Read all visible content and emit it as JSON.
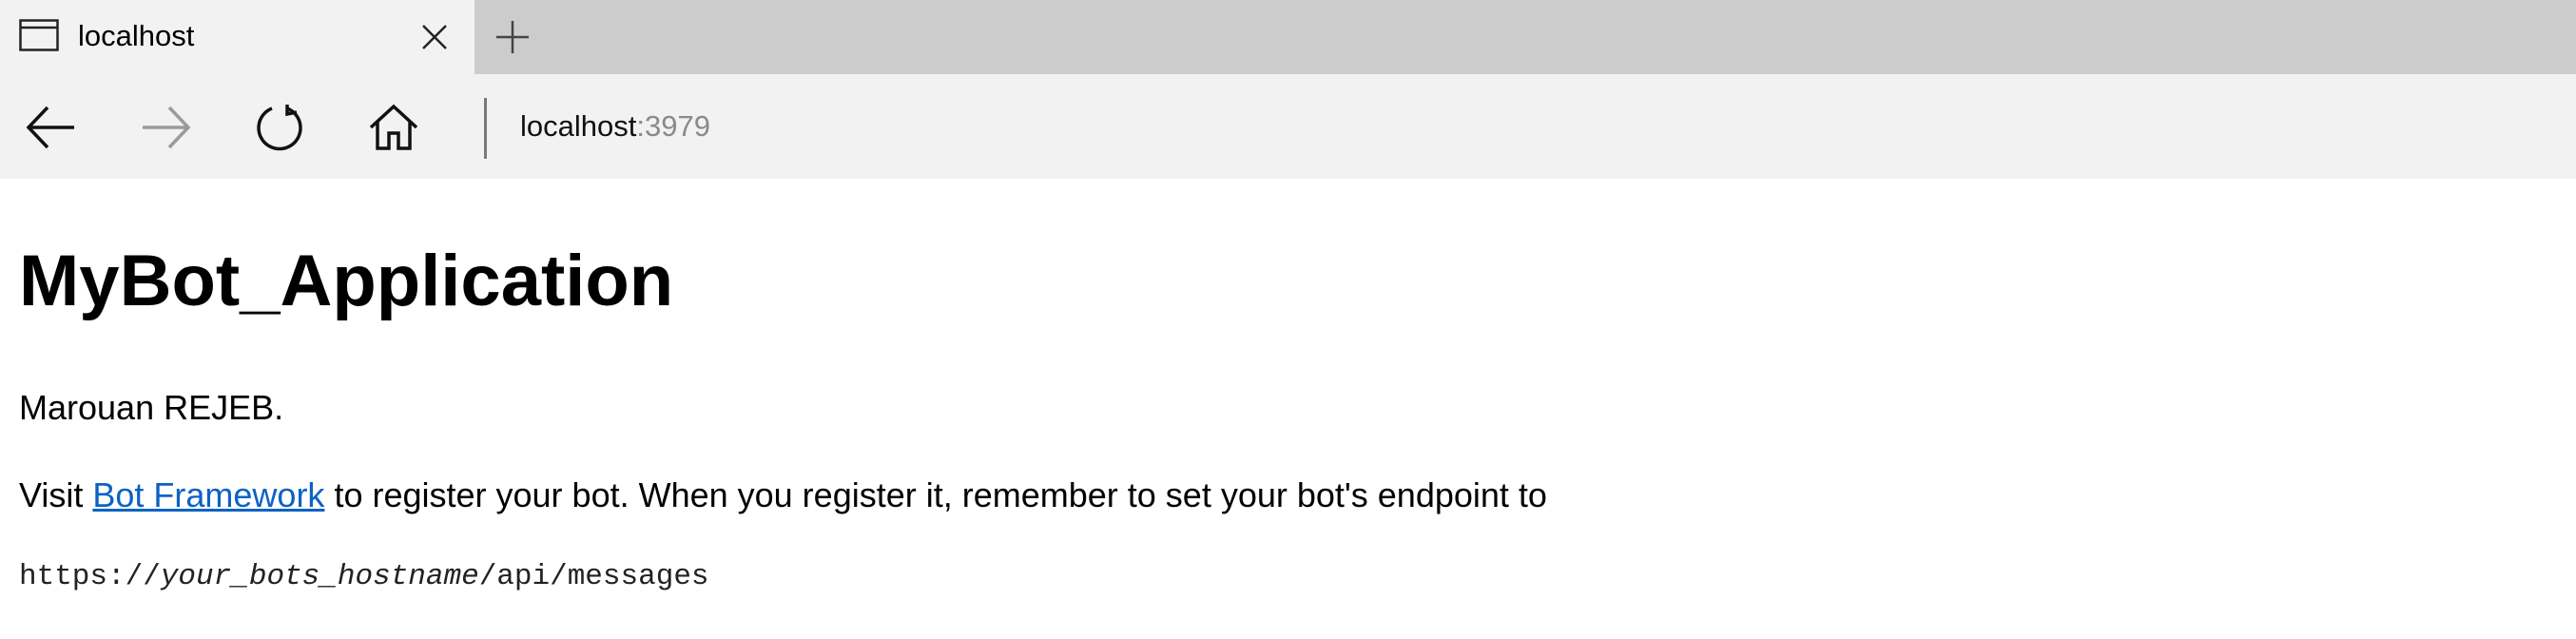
{
  "browser": {
    "tab": {
      "title": "localhost",
      "icon": "page-icon",
      "close_icon": "close-icon"
    },
    "new_tab_icon": "plus-icon",
    "nav": {
      "back_icon": "back-arrow-icon",
      "forward_icon": "forward-arrow-icon",
      "refresh_icon": "refresh-icon",
      "home_icon": "home-icon"
    },
    "address": {
      "host": "localhost",
      "port": ":3979"
    }
  },
  "page": {
    "title": "MyBot_Application",
    "author": "Marouan REJEB.",
    "visit_prefix": "Visit ",
    "link_text": "Bot Framework",
    "visit_suffix": " to register your bot. When you register it, remember to set your bot's endpoint to",
    "endpoint": {
      "scheme": "https://",
      "host_placeholder": "your_bots_hostname",
      "path": "/api/messages"
    }
  },
  "colors": {
    "tabstrip_bg": "#cccccc",
    "toolbar_bg": "#f2f2f2",
    "link": "#0b62c4",
    "port_gray": "#8a8a8a",
    "forward_disabled": "#9a9a9a"
  }
}
